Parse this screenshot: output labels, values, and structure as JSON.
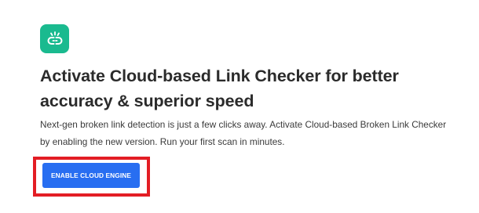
{
  "brand": {
    "logo_icon": "broken-link-checker-icon",
    "accent_color": "#1aba8f"
  },
  "content": {
    "title": "Activate Cloud-based Link Checker for better accuracy & superior speed",
    "description": "Next-gen broken link detection is just a few clicks away. Activate Cloud-based Broken Link Checker by enabling the new version. Run your first scan in minutes."
  },
  "actions": {
    "enable_button_label": "ENABLE CLOUD ENGINE",
    "button_color": "#286ef1",
    "highlight_color": "#e31d24"
  }
}
